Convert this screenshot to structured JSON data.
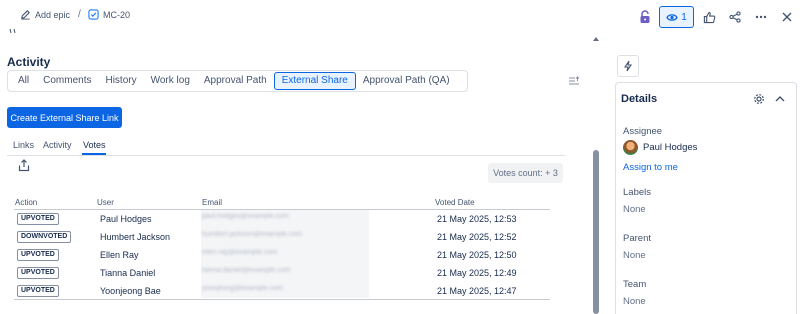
{
  "topbar": {
    "add_epic_label": "Add epic",
    "separator": "/",
    "issue_key": "MC-20",
    "watch_count": "1"
  },
  "activity": {
    "title": "Activity",
    "tabs": [
      "All",
      "Comments",
      "History",
      "Work log",
      "Approval Path",
      "External Share",
      "Approval Path (QA)"
    ],
    "active_tab": "External Share",
    "create_button": "Create External Share Link",
    "subtabs": [
      "Links",
      "Activity",
      "Votes"
    ],
    "active_subtab": "Votes",
    "votes_count": "Votes count: + 3"
  },
  "votes_table": {
    "headers": [
      "Action",
      "User",
      "Email",
      "Voted Date"
    ],
    "rows": [
      {
        "action": "UPVOTED",
        "user": "Paul Hodges",
        "email": "paul.hodges@example.com",
        "date": "21 May 2025, 12:53"
      },
      {
        "action": "DOWNVOTED",
        "user": "Humbert Jackson",
        "email": "humbert.jackson@example.com",
        "date": "21 May 2025, 12:52"
      },
      {
        "action": "UPVOTED",
        "user": "Ellen Ray",
        "email": "ellen.ray@example.com",
        "date": "21 May 2025, 12:50"
      },
      {
        "action": "UPVOTED",
        "user": "Tianna Daniel",
        "email": "tianna.daniel@example.com",
        "date": "21 May 2025, 12:49"
      },
      {
        "action": "UPVOTED",
        "user": "Yoonjeong Bae",
        "email": "yoonjeong@example.com",
        "date": "21 May 2025, 12:47"
      }
    ]
  },
  "details": {
    "title": "Details",
    "assignee_label": "Assignee",
    "assignee_name": "Paul Hodges",
    "assign_to_me": "Assign to me",
    "labels_label": "Labels",
    "labels_value": "None",
    "parent_label": "Parent",
    "parent_value": "None",
    "team_label": "Team",
    "team_value": "None"
  },
  "colors": {
    "accent": "#0c66e4",
    "accent_bg": "#e9f2ff",
    "lock": "#6e5dc6"
  },
  "icons": [
    "edit-icon",
    "checkbox-issue-icon",
    "lock-icon",
    "eye-icon",
    "thumbs-up-icon",
    "share-icon",
    "more-icon",
    "close-icon",
    "sort-icon",
    "export-icon",
    "lightning-icon",
    "gear-icon",
    "chevron-up-icon"
  ]
}
